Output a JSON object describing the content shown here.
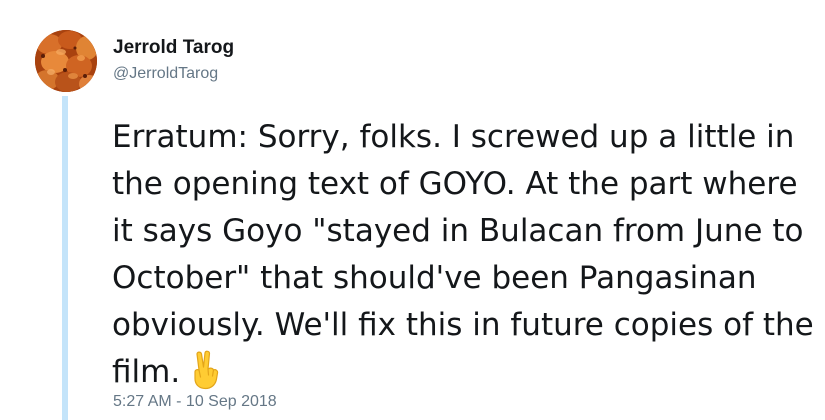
{
  "tweet": {
    "author": {
      "display_name": "Jerrold Tarog",
      "handle": "@JerroldTarog"
    },
    "text": "Erratum: Sorry, folks. I screwed up a little in the opening text of GOYO. At the part where it says Goyo \"stayed in Bulacan from June to October\" that should've been Pangasinan obviously. We'll fix this in future copies of the film.",
    "emoji": "victory-hand-icon",
    "timestamp": "5:27 AM - 10 Sep 2018"
  },
  "colors": {
    "text": "#14171a",
    "secondary": "#657786",
    "thread_line": "#c4e4fa",
    "emoji": "#ffcc33"
  }
}
